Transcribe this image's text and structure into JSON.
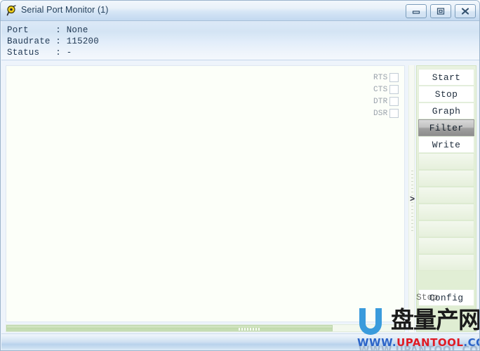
{
  "window": {
    "title": "Serial Port Monitor (1)",
    "icon": "app-icon",
    "minimize_label": "",
    "maximize_label": "",
    "close_label": ""
  },
  "info": {
    "rows": [
      "Port     : None",
      "Baudrate : 115200",
      "Status   : -"
    ],
    "port_label": "Port",
    "port_value": "None",
    "baudrate_label": "Baudrate",
    "baudrate_value": "115200",
    "status_label": "Status",
    "status_value": "-"
  },
  "console": {
    "text": ""
  },
  "scrollbar": {
    "orientation": "horizontal"
  },
  "splitter": {
    "arrow": ">"
  },
  "signals": [
    {
      "label": "RTS",
      "checked": false
    },
    {
      "label": "CTS",
      "checked": false
    },
    {
      "label": "DTR",
      "checked": false
    },
    {
      "label": "DSR",
      "checked": false
    }
  ],
  "buttons": [
    {
      "label": "Start",
      "state": "normal"
    },
    {
      "label": "Stop",
      "state": "normal"
    },
    {
      "label": "Graph",
      "state": "normal"
    },
    {
      "label": "Filter",
      "state": "active"
    },
    {
      "label": "Write",
      "state": "normal"
    },
    {
      "label": "",
      "state": "empty"
    },
    {
      "label": "",
      "state": "empty"
    },
    {
      "label": "",
      "state": "empty"
    },
    {
      "label": "",
      "state": "empty"
    },
    {
      "label": "",
      "state": "empty"
    },
    {
      "label": "",
      "state": "empty"
    },
    {
      "label": "",
      "state": "empty"
    },
    {
      "label": "Config",
      "state": "normal"
    }
  ],
  "statusbar": {
    "text": ""
  },
  "watermark": {
    "letter": "U",
    "chinese": "盘量产网",
    "url_www": "WWW.",
    "url_name": "UPANTOOL",
    "url_dot": ".",
    "url_tld": "COM",
    "shadow_text": "WWW.UPANTOOL.COM",
    "ghost_text": "Stop"
  },
  "colors": {
    "titlebar": "#cfe1f4",
    "info_panel": "#d4e4f4",
    "console_bg": "#fcfff9",
    "right_panel": "#e2eed6",
    "active_button": "#9f9f9f",
    "scrollbar_thumb": "#c8deb5",
    "watermark_blue": "#2b64c8",
    "watermark_red": "#e01b24"
  }
}
